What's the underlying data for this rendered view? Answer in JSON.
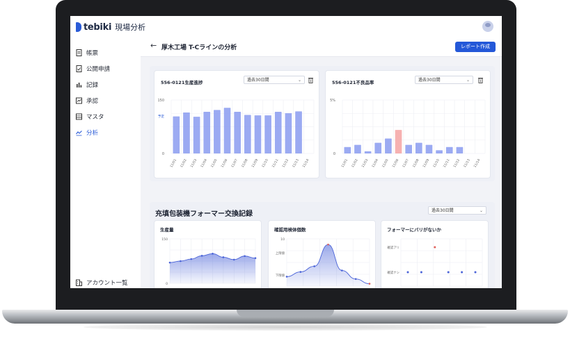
{
  "app": {
    "logo_text": "tebiki",
    "logo_sub": "現場分析"
  },
  "sidebar": {
    "items": [
      {
        "label": "帳票",
        "icon": "document-icon",
        "active": false
      },
      {
        "label": "公開申請",
        "icon": "document-check-icon",
        "active": false
      },
      {
        "label": "記録",
        "icon": "bar-chart-icon",
        "active": false
      },
      {
        "label": "承認",
        "icon": "approve-icon",
        "active": false
      },
      {
        "label": "マスタ",
        "icon": "list-icon",
        "active": false
      },
      {
        "label": "分析",
        "icon": "trend-icon",
        "active": true
      }
    ],
    "account_label": "アカウント一覧"
  },
  "header": {
    "back_arrow": "←",
    "title": "厚木工場 T-Cラインの分析",
    "report_button": "レポート作成"
  },
  "colors": {
    "accent": "#2458d8",
    "bar": "#8a9bf0",
    "bar_highlight": "#f4a3a3",
    "line": "#4a63d8"
  },
  "top_cards": [
    {
      "title": "556-0121生産進捗",
      "range": "過去30日間",
      "y_top": "150",
      "y_zero": "0",
      "marker_label": "予定"
    },
    {
      "title": "556-0121不良品率",
      "range": "過去30日間",
      "y_top": "5%",
      "y_zero": "0"
    }
  ],
  "section": {
    "title": "充填包装機フォーマー交換記録",
    "range": "過去30日間"
  },
  "bottom_cards": [
    {
      "title": "生産量",
      "y_top": "150",
      "y_zero": "0"
    },
    {
      "title": "確認用検体個数",
      "y_top": "10",
      "y_mid1": "上限値",
      "y_mid2": "下限値"
    },
    {
      "title": "フォーマーにバリがないか",
      "row1": "確認アリ",
      "row2": "確認ナシ"
    }
  ],
  "chart_data": [
    {
      "type": "bar",
      "title": "556-0121生産進捗",
      "categories": [
        "11/01",
        "11/02",
        "11/03",
        "11/04",
        "11/05",
        "11/06",
        "11/07",
        "11/08",
        "11/09",
        "11/10",
        "11/11",
        "11/12",
        "11/13",
        "11/14"
      ],
      "values": [
        104,
        115,
        103,
        117,
        122,
        128,
        117,
        108,
        107,
        107,
        117,
        113,
        118
      ],
      "ylim": [
        0,
        150
      ],
      "annotations": [
        "予定"
      ]
    },
    {
      "type": "bar",
      "title": "556-0121不良品率",
      "categories": [
        "11/01",
        "11/02",
        "11/03",
        "11/04",
        "11/05",
        "11/06",
        "11/07",
        "11/08",
        "11/09",
        "11/10",
        "11/11",
        "11/12",
        "11/13",
        "11/14"
      ],
      "values": [
        0.6,
        0.8,
        0.2,
        1.0,
        1.4,
        2.2,
        0.8,
        1.0,
        0.8,
        0.3,
        0.6,
        0.6
      ],
      "highlight_index": 5,
      "ylim": [
        0,
        5
      ]
    },
    {
      "type": "area",
      "title": "生産量",
      "categories": [
        "11/01",
        "11/02",
        "11/03",
        "11/04",
        "11/05",
        "11/06",
        "11/07",
        "11/08",
        "11/09"
      ],
      "values": [
        70,
        75,
        82,
        93,
        100,
        88,
        80,
        92,
        85
      ],
      "ylim": [
        0,
        150
      ]
    },
    {
      "type": "area",
      "title": "確認用検体個数",
      "categories": [
        "11/01",
        "11/02",
        "11/03",
        "11/04",
        "11/05",
        "11/06"
      ],
      "values": [
        2.0,
        3.0,
        4.2,
        8.8,
        3.3,
        1.5,
        0.5
      ],
      "highlight_category": "11/03",
      "ylim": [
        0,
        10
      ]
    },
    {
      "type": "scatter",
      "title": "フォーマーにバリがないか",
      "categories": [
        "11/01",
        "11/02",
        "11/03",
        "11/04",
        "11/05",
        "11/06"
      ],
      "values": [
        "確認ナシ",
        "確認ナシ",
        "確認アリ",
        "確認ナシ",
        "確認ナシ",
        "確認ナシ"
      ],
      "highlight_category": "11/03"
    }
  ]
}
